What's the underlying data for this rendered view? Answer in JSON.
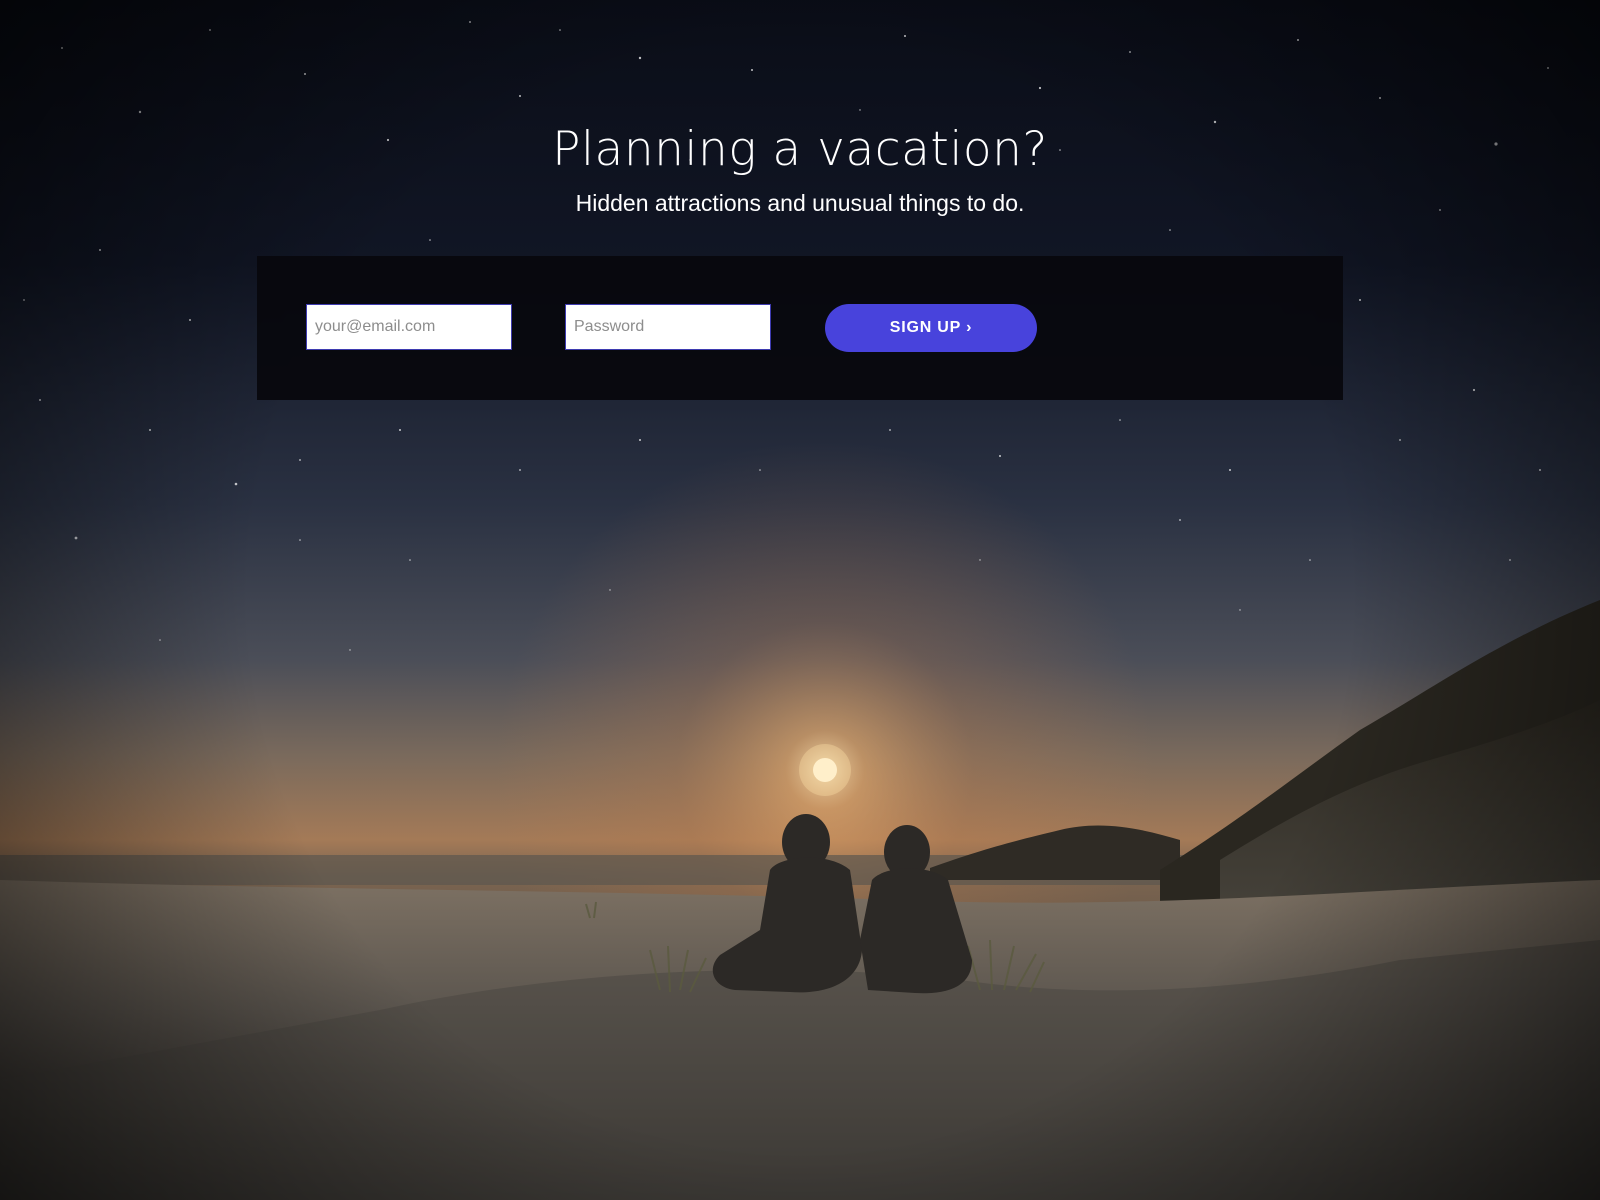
{
  "hero": {
    "headline": "Planning a vacation?",
    "subheadline": "Hidden attractions and unusual things to do."
  },
  "signup_form": {
    "email_placeholder": "your@email.com",
    "email_value": "",
    "password_placeholder": "Password",
    "password_value": "",
    "submit_label": "SIGN UP",
    "submit_chevron": "›"
  },
  "background": {
    "description_icon": "night-beach-photo",
    "sky_top_color": "#0a0e1a",
    "horizon_glow_color": "#e39a5a",
    "sand_color": "#6e665d"
  },
  "colors": {
    "accent": "#4843dc",
    "panel": "#07080d",
    "text": "#ffffff",
    "placeholder": "#8d8d8d"
  }
}
